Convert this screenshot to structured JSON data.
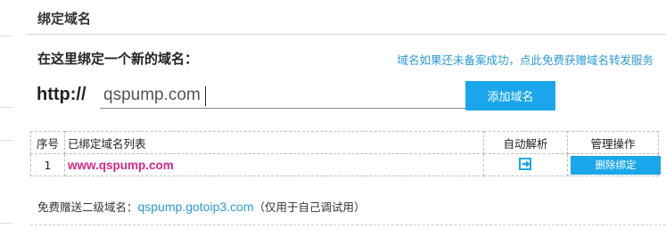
{
  "section": {
    "title": "绑定域名"
  },
  "bind_form": {
    "heading": "在这里绑定一个新的域名：",
    "notice_link": "域名如果还未备案成功，点此免费获赠域名转发服务",
    "protocol": "http://",
    "domain_value": "qspump.com",
    "add_button": "添加域名"
  },
  "table": {
    "headers": {
      "seq": "序号",
      "list": "已绑定域名列表",
      "parse": "自动解析",
      "manage": "管理操作"
    },
    "rows": [
      {
        "seq": "1",
        "domain": "www.qspump.com",
        "parse_icon": "auto-parse-icon",
        "action": "删除绑定"
      }
    ]
  },
  "free_domain": {
    "label": "免费赠送二级域名：",
    "domain": "qspump.gotoip3.com",
    "note": "（仅用于自己调试用）"
  },
  "colors": {
    "accent": "#1aa6ea",
    "link": "#2a9ad6",
    "domain_highlight": "#d6278c"
  }
}
